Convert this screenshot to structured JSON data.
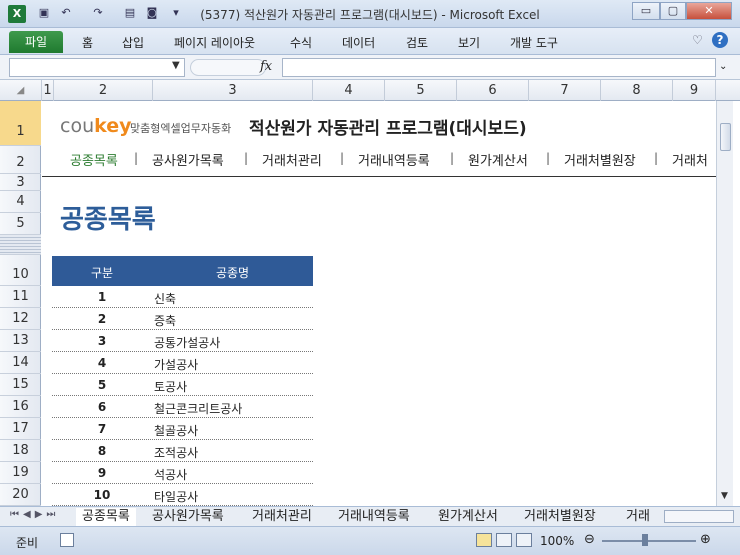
{
  "window": {
    "title": "(5377) 적산원가 자동관리 프로그램(대시보드)  -  Microsoft Excel",
    "app_icon": "X",
    "minimize": "▭",
    "maximize": "▢",
    "close": "✕"
  },
  "ribbon": {
    "file": "파일",
    "tabs": [
      "홈",
      "삽입",
      "페이지 레이아웃",
      "수식",
      "데이터",
      "검토",
      "보기",
      "개발 도구"
    ]
  },
  "formula_bar": {
    "name_box": "",
    "fx": "fx",
    "formula": ""
  },
  "columns": [
    "1",
    "2",
    "3",
    "4",
    "5",
    "6",
    "7",
    "8",
    "9"
  ],
  "rows": [
    "1",
    "2",
    "3",
    "4",
    "5",
    "10",
    "11",
    "12",
    "13",
    "14",
    "15",
    "16",
    "17",
    "18",
    "19",
    "20"
  ],
  "sheet": {
    "logo_co": "cou",
    "logo_key": "key",
    "brand": "맞춤형엑셀업무자동화",
    "heading": "적산원가 자동관리 프로그램(대시보드)",
    "nav": [
      "공종목록",
      "공사원가목록",
      "거래처관리",
      "거래내역등록",
      "원가계산서",
      "거래처별원장",
      "거래처"
    ],
    "page_title": "공종목록",
    "table": {
      "headers": [
        "구분",
        "공종명"
      ],
      "rows": [
        {
          "no": "1",
          "name": "신축"
        },
        {
          "no": "2",
          "name": "증축"
        },
        {
          "no": "3",
          "name": "공통가설공사"
        },
        {
          "no": "4",
          "name": "가설공사"
        },
        {
          "no": "5",
          "name": "토공사"
        },
        {
          "no": "6",
          "name": "철근콘크리트공사"
        },
        {
          "no": "7",
          "name": "철골공사"
        },
        {
          "no": "8",
          "name": "조적공사"
        },
        {
          "no": "9",
          "name": "석공사"
        },
        {
          "no": "10",
          "name": "타일공사"
        }
      ]
    }
  },
  "sheet_tabs": [
    "공종목록",
    "공사원가목록",
    "거래처관리",
    "거래내역등록",
    "원가계산서",
    "거래처별원장",
    "거래"
  ],
  "status": {
    "ready": "준비",
    "zoom": "100%"
  },
  "colors": {
    "accent": "#2f5a97",
    "title_text": "#2d5d99",
    "logo_orange": "#f08a1c",
    "nav_active": "#2e7d32"
  }
}
